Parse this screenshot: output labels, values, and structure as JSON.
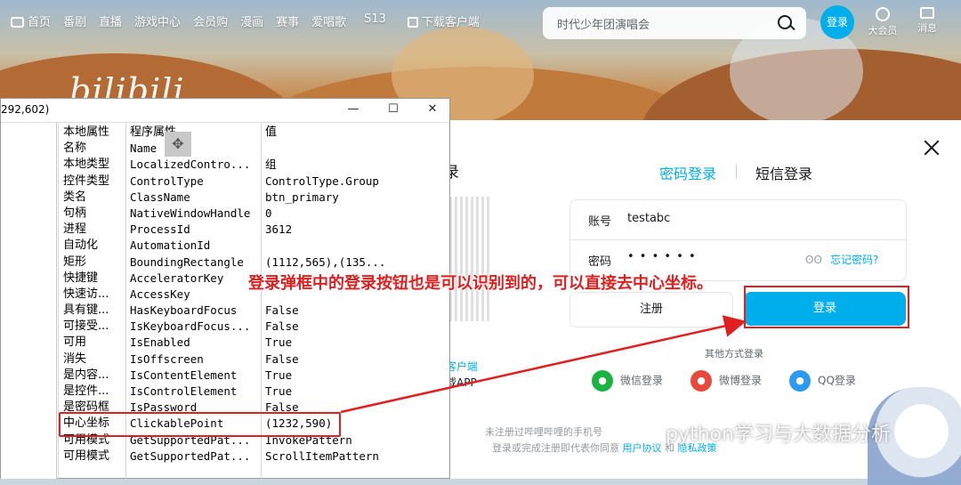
{
  "header": {
    "nav": [
      "首页",
      "番剧",
      "直播",
      "游戏中心",
      "会员购",
      "漫画",
      "赛事",
      "爱唱歌",
      "S13"
    ],
    "download_label": "下载客户端",
    "logo": "bilibili",
    "search_placeholder": "时代少年团演唱会",
    "login_avatar": "登录",
    "vip_label": "大会员",
    "messages_label": "消息"
  },
  "login_modal": {
    "scan_title": "扫描二维码登录",
    "scan_title_visible": "录",
    "qr_line1": "客户端",
    "qr_line2": "载APP",
    "tab_password": "密码登录",
    "tab_sms": "短信登录",
    "account_label": "账号",
    "account_value": "testabc",
    "password_label": "密码",
    "password_value": "• • • • • •",
    "eye_icon": "ʘʘ",
    "forgot_password": "忘记密码?",
    "register_button": "注册",
    "login_button": "登录",
    "other_methods": "其他方式登录",
    "social": [
      "微信登录",
      "微博登录",
      "QQ登录"
    ],
    "terms_line1": "未注册过哔哩哔哩的手机号",
    "terms_line2_prefix": "登录或完成注册即代表你同意",
    "terms_line2_link1": "用户协议",
    "terms_line2_mid": "和",
    "terms_line2_link2": "隐私政策"
  },
  "inspect_window": {
    "title": "292,602)",
    "buttons": {
      "minimize": "—",
      "maximize": "☐",
      "close": "✕"
    },
    "columns": [
      "本地属性",
      "程序属性",
      "值"
    ],
    "rows": [
      {
        "local": "名称",
        "prop": "Name",
        "value": ""
      },
      {
        "local": "本地类型",
        "prop": "LocalizedContro...",
        "value": "组"
      },
      {
        "local": "控件类型",
        "prop": "ControlType",
        "value": "ControlType.Group"
      },
      {
        "local": "类名",
        "prop": "ClassName",
        "value": "btn_primary"
      },
      {
        "local": "句柄",
        "prop": "NativeWindowHandle",
        "value": "0"
      },
      {
        "local": "进程",
        "prop": "ProcessId",
        "value": "3612"
      },
      {
        "local": "自动化",
        "prop": "AutomationId",
        "value": ""
      },
      {
        "local": "矩形",
        "prop": "BoundingRectangle",
        "value": "(1112,565),(135..."
      },
      {
        "local": "快捷键",
        "prop": "AcceleratorKey",
        "value": ""
      },
      {
        "local": "快速访...",
        "prop": "AccessKey",
        "value": ""
      },
      {
        "local": "具有键...",
        "prop": "HasKeyboardFocus",
        "value": "False"
      },
      {
        "local": "可接受...",
        "prop": "IsKeyboardFocus...",
        "value": "False"
      },
      {
        "local": "可用",
        "prop": "IsEnabled",
        "value": "True"
      },
      {
        "local": "消失",
        "prop": "IsOffscreen",
        "value": "False"
      },
      {
        "local": "是内容...",
        "prop": "IsContentElement",
        "value": "True"
      },
      {
        "local": "是控件...",
        "prop": "IsControlElement",
        "value": "True"
      },
      {
        "local": "是密码框",
        "prop": "IsPassword",
        "value": "False"
      },
      {
        "local": "中心坐标",
        "prop": "ClickablePoint",
        "value": "(1232,590)"
      },
      {
        "local": "可用模式",
        "prop": "GetSupportedPat...",
        "value": "InvokePattern"
      },
      {
        "local": "可用模式",
        "prop": "GetSupportedPat...",
        "value": "ScrollItemPattern"
      }
    ]
  },
  "annotation": "登录弹框中的登录按钮也是可以识别到的，可以直接去中心坐标。",
  "watermark": "python学习与大数据分析",
  "colors": {
    "accent": "#00aeec",
    "annotation_red": "#e02020"
  }
}
